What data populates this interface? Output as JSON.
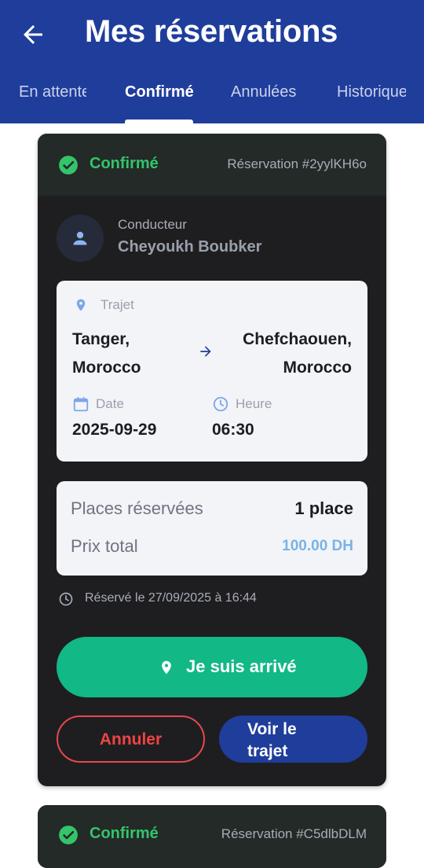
{
  "header": {
    "title": "Mes réservations",
    "back_icon": "arrow-left-icon"
  },
  "tabs": [
    {
      "label": "En attente",
      "active": false
    },
    {
      "label": "Confirmé",
      "active": true
    },
    {
      "label": "Annulées",
      "active": false
    },
    {
      "label": "Historique",
      "active": false
    }
  ],
  "reservation": {
    "status": "Confirmé",
    "status_icon": "check-circle-icon",
    "reservation_id": "Réservation #2yylKH6o",
    "driver_label": "Conducteur",
    "driver_name": "Cheyoukh Boubker",
    "trip_label": "Trajet",
    "from_line1": "Tanger,",
    "from_line2": "Morocco",
    "to_line1": "Chefchaouen,",
    "to_line2": "Morocco",
    "date_label": "Date",
    "date_value": "2025-09-29",
    "time_label": "Heure",
    "time_value": "06:30",
    "seats_label": "Places réservées",
    "seats_value": "1 place",
    "total_label": "Prix total",
    "total_value": "100.00 DH",
    "booked_at": "Réservé le 27/09/2025 à 16:44",
    "arrive_button": "Je suis arrivé",
    "cancel_button": "Annuler",
    "view_route_button": "Voir le trajet"
  },
  "next_reservation": {
    "status": "Confirmé",
    "reservation_id": "Réservation #C5dlbDLM"
  },
  "colors": {
    "primary": "#1f3d9a",
    "success": "#34c46b",
    "arrive_button": "#12b886",
    "danger": "#ef4444",
    "price": "#79b3e6",
    "card_bg": "#1e1e21"
  }
}
